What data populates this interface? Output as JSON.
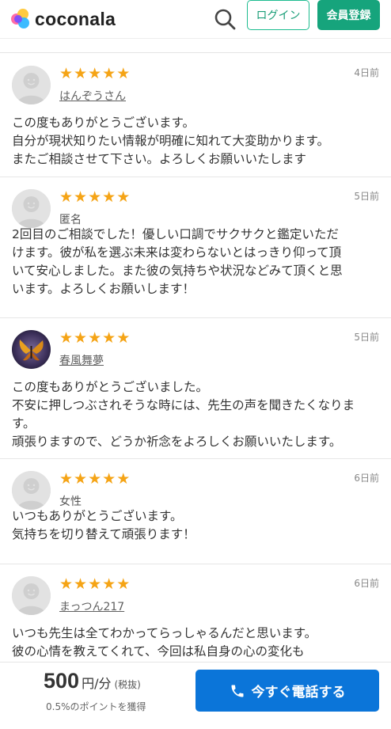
{
  "header": {
    "logo_text": "coconala",
    "login_label": "ログイン",
    "signup_label": "会員登録"
  },
  "reviews": [
    {
      "rating": 5,
      "reviewer": "はんぞうさん",
      "date": "4日前",
      "lines": [
        "この度もありがとうございます。",
        "自分が現状知りたい情報が明確に知れて大変助かります。",
        "またご相談させて下さい。よろしくお願いいたします"
      ]
    },
    {
      "rating": 5,
      "reviewer": "匿名",
      "date": "5日前",
      "lines": [
        "2回目のご相談でした！優しい口調でサクサクと鑑定いただ",
        "けます。彼が私を選ぶ未来は変わらないとはっきり仰って頂",
        "いて安心しました。また彼の気持ちや状況などみて頂くと思",
        "います。よろしくお願いします！"
      ]
    },
    {
      "rating": 5,
      "reviewer": "春風舞夢",
      "date": "5日前",
      "lines": [
        "この度もありがとうございました。",
        "不安に押しつぶされそうな時には、先生の声を聞きたくなりま",
        "す。",
        "頑張りますので、どうか祈念をよろしくお願いいたします。"
      ]
    },
    {
      "rating": 5,
      "reviewer": "女性",
      "date": "6日前",
      "lines": [
        "いつもありがとうございます。",
        "気持ちを切り替えて頑張ります！"
      ]
    },
    {
      "rating": 5,
      "reviewer": "まっつん217",
      "date": "6日前",
      "lines": [
        "いつも先生は全てわかってらっしゃるんだと思います。",
        "彼の心情を教えてくれて、今回は私自身の心の変化も"
      ]
    }
  ],
  "bottom_bar": {
    "price": "500",
    "unit": "円/分",
    "tax": "(税抜)",
    "points": "0.5%のポイントを獲得",
    "call_label": "今すぐ電話する"
  },
  "colors": {
    "brand_green": "#16a47c",
    "star": "#f5a416",
    "call_blue": "#0b75d9"
  }
}
